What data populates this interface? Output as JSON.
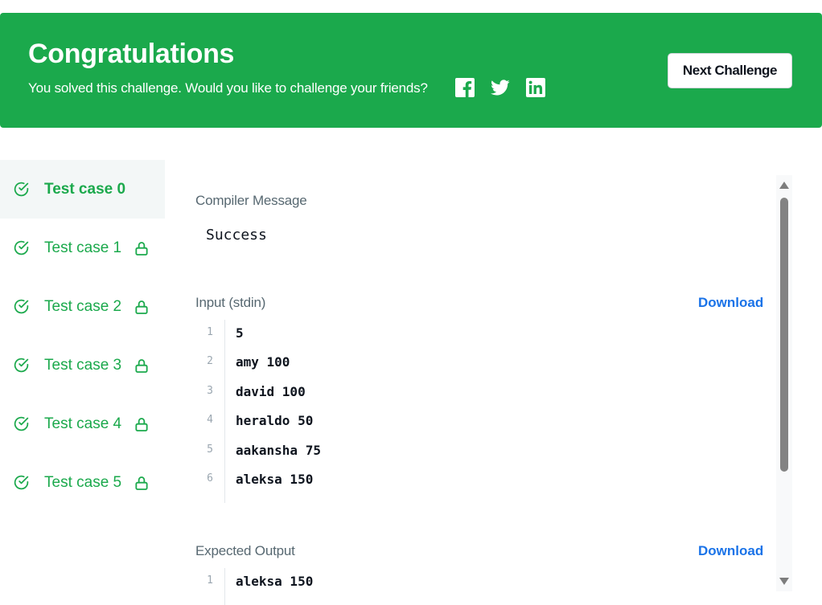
{
  "banner": {
    "title": "Congratulations",
    "subtitle": "You solved this challenge. Would you like to challenge your friends?",
    "next_button": "Next Challenge",
    "social": [
      "facebook-icon",
      "twitter-icon",
      "linkedin-icon"
    ],
    "bg_color": "#1ba94c"
  },
  "sidebar": {
    "items": [
      {
        "label": "Test case 0",
        "active": true,
        "locked": false
      },
      {
        "label": "Test case 1",
        "active": false,
        "locked": true
      },
      {
        "label": "Test case 2",
        "active": false,
        "locked": true
      },
      {
        "label": "Test case 3",
        "active": false,
        "locked": true
      },
      {
        "label": "Test case 4",
        "active": false,
        "locked": true
      },
      {
        "label": "Test case 5",
        "active": false,
        "locked": true
      }
    ]
  },
  "compiler": {
    "label": "Compiler Message",
    "message": "Success"
  },
  "input": {
    "label": "Input (stdin)",
    "download": "Download",
    "lines": [
      {
        "n": "1",
        "text": "5"
      },
      {
        "n": "2",
        "text": "amy 100"
      },
      {
        "n": "3",
        "text": "david 100"
      },
      {
        "n": "4",
        "text": "heraldo 50"
      },
      {
        "n": "5",
        "text": "aakansha 75"
      },
      {
        "n": "6",
        "text": "aleksa 150"
      }
    ]
  },
  "expected": {
    "label": "Expected Output",
    "download": "Download",
    "lines": [
      {
        "n": "1",
        "text": "aleksa 150"
      }
    ]
  }
}
